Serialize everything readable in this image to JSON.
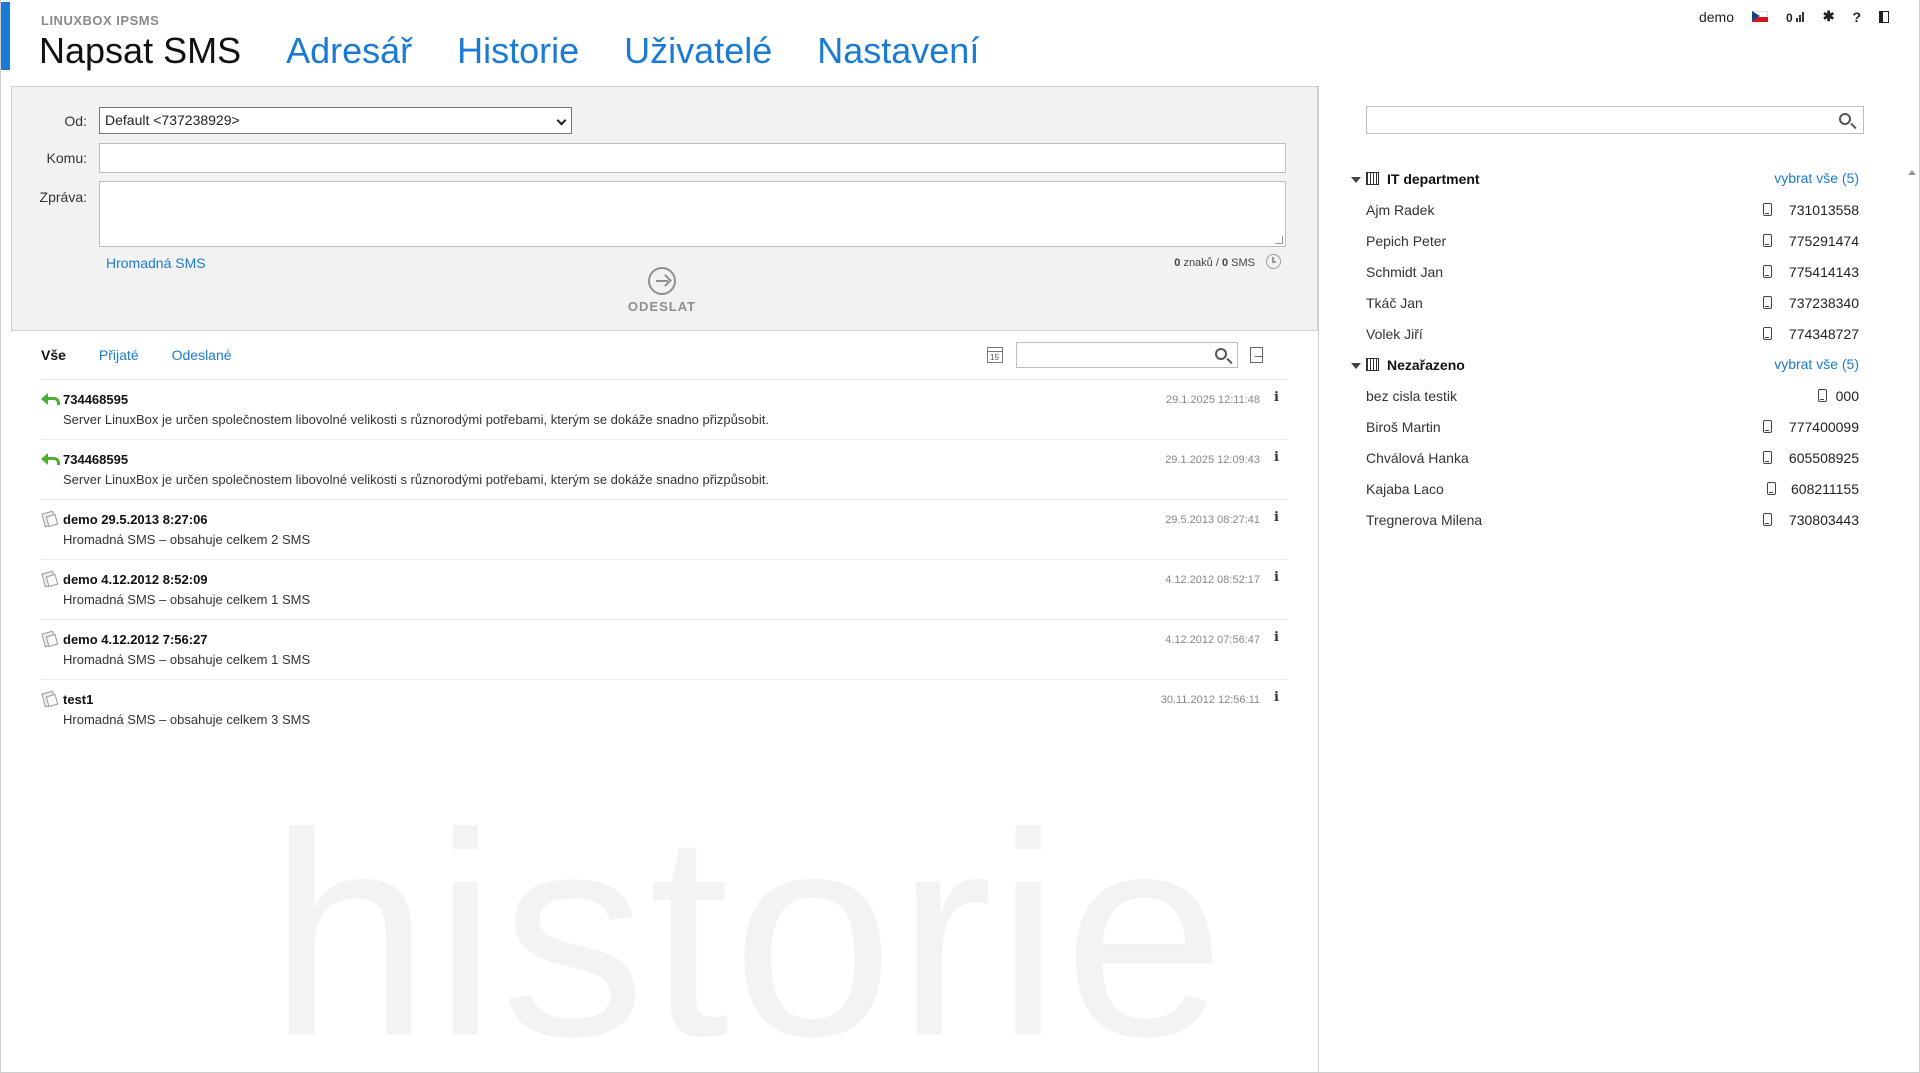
{
  "brand": "LINUXBOX IPSMS",
  "nav": [
    "Napsat SMS",
    "Adresář",
    "Historie",
    "Uživatelé",
    "Nastavení"
  ],
  "topbar": {
    "user": "demo",
    "credit": "0",
    "settings_icon": "gear-icon",
    "help": "?",
    "logout_icon": "logout-icon"
  },
  "compose": {
    "from_label": "Od:",
    "from_value": "Default <737238929>",
    "to_label": "Komu:",
    "to_value": "",
    "message_label": "Zpráva:",
    "message_value": "",
    "bulk_link": "Hromadná SMS",
    "chars": "0",
    "chars_label": "znaků /",
    "sms": "0",
    "sms_label": "SMS",
    "send_label": "ODESLAT"
  },
  "history": {
    "filters": [
      "Vše",
      "Přijaté",
      "Odeslané"
    ],
    "calendar_day": "15",
    "search_value": "",
    "messages": [
      {
        "icon": "reply-icon",
        "title": "734468595",
        "text": "Server LinuxBox je určen společnostem libovolné velikosti s různorodými potřebami, kterým se dokáže snadno přizpůsobit.",
        "date": "29.1.2025 12:11:48"
      },
      {
        "icon": "reply-icon",
        "title": "734468595",
        "text": "Server LinuxBox je určen společnostem libovolné velikosti s různorodými potřebami, kterým se dokáže snadno přizpůsobit.",
        "date": "29.1.2025 12:09:43"
      },
      {
        "icon": "bulk-sms-icon",
        "title": "demo 29.5.2013 8:27:06",
        "text": "Hromadná SMS – obsahuje celkem 2 SMS",
        "date": "29.5.2013 08:27:41"
      },
      {
        "icon": "bulk-sms-icon",
        "title": "demo 4.12.2012 8:52:09",
        "text": "Hromadná SMS – obsahuje celkem 1 SMS",
        "date": "4.12.2012 08:52:17"
      },
      {
        "icon": "bulk-sms-icon",
        "title": "demo 4.12.2012 7:56:27",
        "text": "Hromadná SMS – obsahuje celkem 1 SMS",
        "date": "4.12.2012 07:56:47"
      },
      {
        "icon": "bulk-sms-icon",
        "title": "test1",
        "text": "Hromadná SMS – obsahuje celkem 3 SMS",
        "date": "30.11.2012 12:56:11"
      }
    ],
    "info": "i",
    "watermark": "historie"
  },
  "contacts": {
    "search_value": "",
    "groups": [
      {
        "name": "IT department",
        "select_all": "vybrat vše (5)",
        "members": [
          {
            "name": "Ajm Radek",
            "phone": "731013558"
          },
          {
            "name": "Pepich Peter",
            "phone": "775291474"
          },
          {
            "name": "Schmidt Jan",
            "phone": "775414143"
          },
          {
            "name": "Tkáč Jan",
            "phone": "737238340"
          },
          {
            "name": "Volek Jiří",
            "phone": "774348727"
          }
        ]
      },
      {
        "name": "Nezařazeno",
        "select_all": "vybrat vše (5)",
        "members": [
          {
            "name": "bez cisla testik",
            "phone": "000"
          },
          {
            "name": "Biroš Martin",
            "phone": "777400099"
          },
          {
            "name": "Chválová Hanka",
            "phone": "605508925"
          },
          {
            "name": "Kajaba Laco",
            "phone": "608211155"
          },
          {
            "name": "Tregnerova Milena",
            "phone": "730803443"
          }
        ]
      }
    ]
  },
  "colors": {
    "accent": "#1a7bd6",
    "reply": "#4caf2f",
    "panel": "#f2f2f2"
  }
}
